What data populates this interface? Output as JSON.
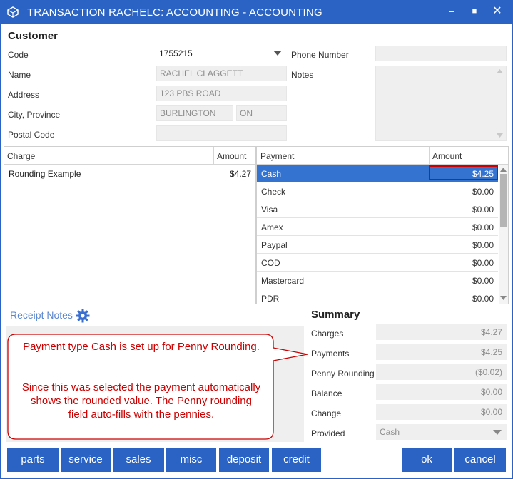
{
  "window": {
    "title": "TRANSACTION RACHELC: ACCOUNTING  - ACCOUNTING",
    "minimize_icon": "minimize-icon",
    "maximize_icon": "maximize-icon",
    "close_icon": "close-icon"
  },
  "customer": {
    "section_title": "Customer",
    "code_label": "Code",
    "code_value": "1755215",
    "name_label": "Name",
    "name_value": "RACHEL CLAGGETT",
    "address_label": "Address",
    "address_value": "123 PBS ROAD",
    "city_label": "City, Province",
    "city_value": "BURLINGTON",
    "province_value": "ON",
    "postal_label": "Postal Code",
    "postal_value": "",
    "phone_label": "Phone Number",
    "phone_value": "",
    "notes_label": "Notes",
    "notes_value": ""
  },
  "charges": {
    "col_charge": "Charge",
    "col_amount": "Amount",
    "rows": [
      {
        "name": "Rounding Example",
        "amount": "$4.27"
      }
    ]
  },
  "payments": {
    "col_payment": "Payment",
    "col_amount": "Amount",
    "rows": [
      {
        "name": "Cash",
        "amount": "$4.25"
      },
      {
        "name": "Check",
        "amount": "$0.00"
      },
      {
        "name": "Visa",
        "amount": "$0.00"
      },
      {
        "name": "Amex",
        "amount": "$0.00"
      },
      {
        "name": "Paypal",
        "amount": "$0.00"
      },
      {
        "name": "COD",
        "amount": "$0.00"
      },
      {
        "name": "Mastercard",
        "amount": "$0.00"
      },
      {
        "name": "PDR",
        "amount": "$0.00"
      }
    ]
  },
  "receipt_notes": {
    "label": "Receipt Notes",
    "callout_line1": "Payment type Cash is set up for Penny Rounding.",
    "callout_line2": "Since this was selected the payment automatically shows the rounded value. The Penny rounding field auto-fills with the pennies."
  },
  "summary": {
    "title": "Summary",
    "charges_label": "Charges",
    "charges_value": "$4.27",
    "payments_label": "Payments",
    "payments_value": "$4.25",
    "penny_label": "Penny Rounding",
    "penny_value": "($0.02)",
    "balance_label": "Balance",
    "balance_value": "$0.00",
    "change_label": "Change",
    "change_value": "$0.00",
    "provided_label": "Provided",
    "provided_value": "Cash"
  },
  "buttons": {
    "parts": "parts",
    "service": "service",
    "sales": "sales",
    "misc": "misc",
    "deposit": "deposit",
    "credit": "credit",
    "ok": "ok",
    "cancel": "cancel"
  },
  "colors": {
    "accent": "#2b63c4",
    "selected_row": "#3573d0",
    "callout": "#cc0000",
    "highlight_box": "#cc0000"
  }
}
